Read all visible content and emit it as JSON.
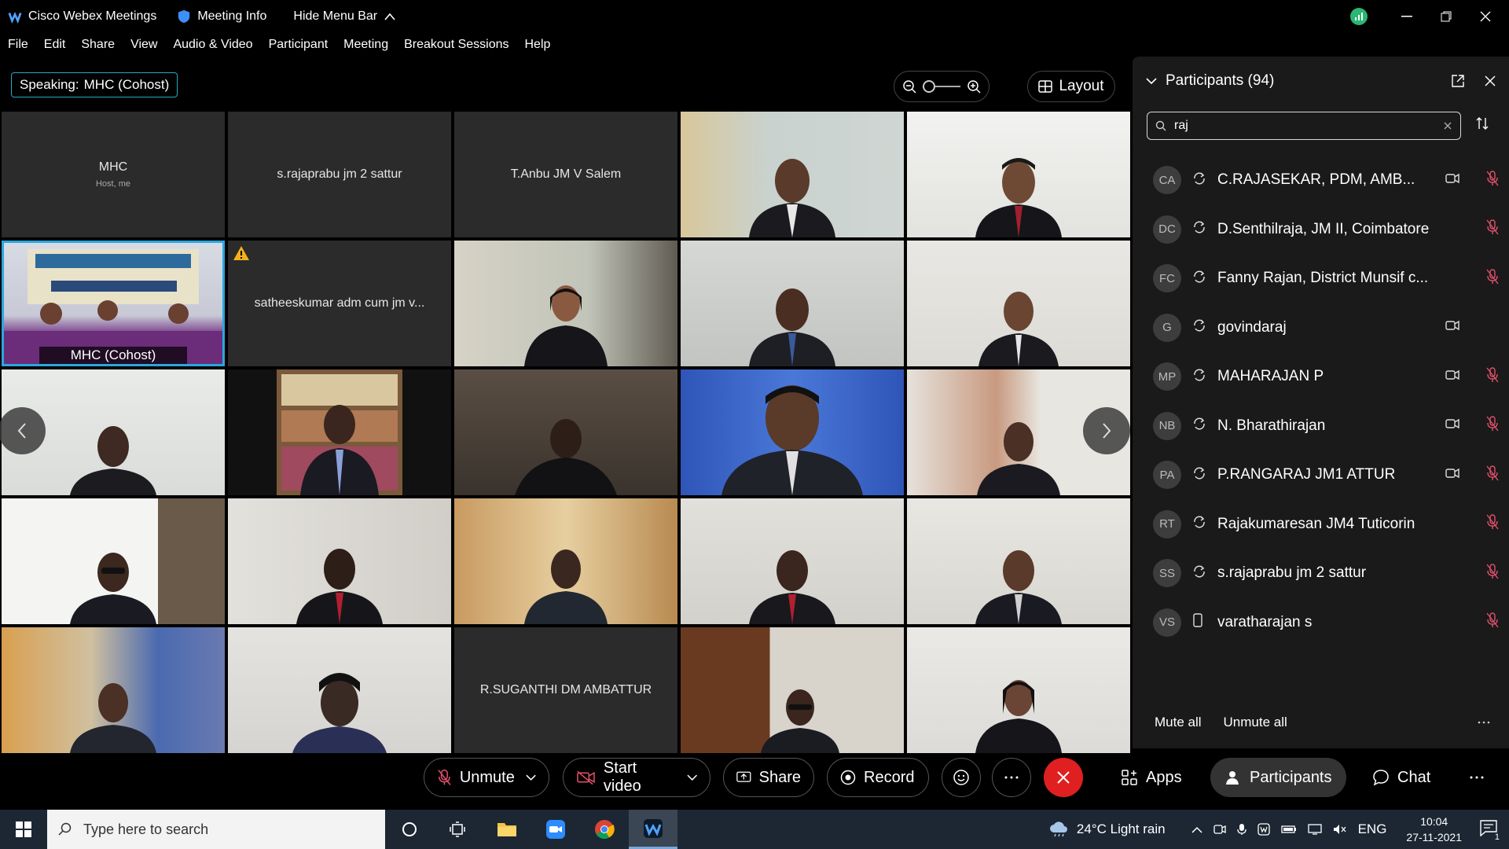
{
  "titlebar": {
    "app_name": "Cisco Webex Meetings",
    "meeting_info": "Meeting Info",
    "hide_menu": "Hide Menu Bar"
  },
  "menu": [
    "File",
    "Edit",
    "Share",
    "View",
    "Audio & Video",
    "Participant",
    "Meeting",
    "Breakout Sessions",
    "Help"
  ],
  "speaking": {
    "label": "Speaking:",
    "name": "MHC (Cohost)"
  },
  "layout_label": "Layout",
  "tiles": {
    "t1_name": "MHC",
    "t1_sub": "Host, me",
    "t2_name": "s.rajaprabu jm 2 sattur",
    "t3_name": "T.Anbu JM V Salem",
    "t6_caption": "MHC  (Cohost)",
    "t7_name": "satheeskumar adm cum jm v...",
    "t23_name": "R.SUGANTHI DM AMBATTUR"
  },
  "panel": {
    "title": "Participants (94)",
    "search_value": "raj",
    "participants": [
      {
        "initials": "CA",
        "name": "C.RAJASEKAR, PDM, AMB...",
        "camera": true,
        "muted": true
      },
      {
        "initials": "DC",
        "name": "D.Senthilraja, JM II, Coimbatore",
        "camera": false,
        "muted": true
      },
      {
        "initials": "FC",
        "name": "Fanny Rajan, District Munsif c...",
        "camera": false,
        "muted": true
      },
      {
        "initials": "G",
        "name": "govindaraj",
        "camera": true,
        "muted": false
      },
      {
        "initials": "MP",
        "name": "MAHARAJAN P",
        "camera": true,
        "muted": true
      },
      {
        "initials": "NB",
        "name": "N. Bharathirajan",
        "camera": true,
        "muted": true
      },
      {
        "initials": "PA",
        "name": "P.RANGARAJ JM1 ATTUR",
        "camera": true,
        "muted": true
      },
      {
        "initials": "RT",
        "name": "Rajakumaresan JM4 Tuticorin",
        "camera": false,
        "muted": true
      },
      {
        "initials": "SS",
        "name": "s.rajaprabu jm 2 sattur",
        "camera": false,
        "muted": true
      },
      {
        "initials": "VS",
        "name": "varatharajan s",
        "camera": false,
        "muted": true
      }
    ],
    "mute_all": "Mute all",
    "unmute_all": "Unmute all"
  },
  "controls": {
    "unmute": "Unmute",
    "start_video": "Start video",
    "share": "Share",
    "record": "Record",
    "apps": "Apps",
    "participants": "Participants",
    "chat": "Chat"
  },
  "taskbar": {
    "search_placeholder": "Type here to search",
    "weather": "24°C  Light rain",
    "lang": "ENG",
    "time": "10:04",
    "date": "27-11-2021",
    "notifications": "1"
  },
  "colors": {
    "accent": "#2aa7e0",
    "end_call": "#e02020",
    "muted_icon": "#e0506a"
  }
}
